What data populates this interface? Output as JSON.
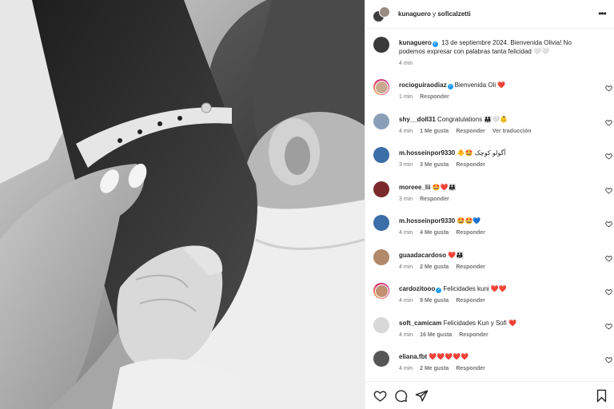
{
  "header": {
    "user1": "kunaguero",
    "joiner": " y ",
    "user2": "soficalzetti"
  },
  "caption": {
    "username": "kunaguero",
    "text": "13 de septiembre 2024. Bienvenida Olivia! No podemos expresar con palabras tanta felicidad 🤍🤍",
    "time": "4 min"
  },
  "comments": [
    {
      "username": "rocioguiraodiaz",
      "verified": true,
      "text": "Bienvenida Oli ❤️",
      "time": "1 min",
      "likes": "",
      "reply": "Responder",
      "translate": ""
    },
    {
      "username": "shy__doll31",
      "verified": false,
      "text": "Congratulations 👨‍👩‍👧🤍👶",
      "time": "4 min",
      "likes": "1 Me gusta",
      "reply": "Responder",
      "translate": "Ver traducción"
    },
    {
      "username": "m.hosseinpor9330",
      "verified": false,
      "text": "🐥🤩 آگولو کوچک",
      "time": "3 min",
      "likes": "3 Me gusta",
      "reply": "Responder",
      "translate": ""
    },
    {
      "username": "moreee_lii",
      "verified": false,
      "text": "🤩❤️👨‍👩‍👧",
      "time": "3 min",
      "likes": "",
      "reply": "Responder",
      "translate": ""
    },
    {
      "username": "m.hosseinpor9330",
      "verified": false,
      "text": "🤩🤩💙",
      "time": "4 min",
      "likes": "4 Me gusta",
      "reply": "Responder",
      "translate": ""
    },
    {
      "username": "guaadacardoso",
      "verified": false,
      "text": "❤️👨‍👩‍👧",
      "time": "4 min",
      "likes": "2 Me gusta",
      "reply": "Responder",
      "translate": ""
    },
    {
      "username": "cardozitooo",
      "verified": true,
      "text": "Felicidades kuni ❤️❤️",
      "time": "4 min",
      "likes": "9 Me gusta",
      "reply": "Responder",
      "translate": ""
    },
    {
      "username": "soft_camicam",
      "verified": false,
      "text": "Felicidades Kun y Sofi ❤️",
      "time": "4 min",
      "likes": "16 Me gusta",
      "reply": "Responder",
      "translate": ""
    },
    {
      "username": "eliana.fbt",
      "verified": false,
      "text": "❤️❤️❤️❤️❤️",
      "time": "4 min",
      "likes": "2 Me gusta",
      "reply": "Responder",
      "translate": ""
    }
  ],
  "icons": {
    "more": "more-options-icon",
    "like": "heart-icon",
    "comment": "comment-icon",
    "share": "send-icon",
    "save": "bookmark-icon"
  },
  "colors": {
    "verified": "#1d9bf0",
    "meta": "#737373",
    "text": "#262626"
  }
}
